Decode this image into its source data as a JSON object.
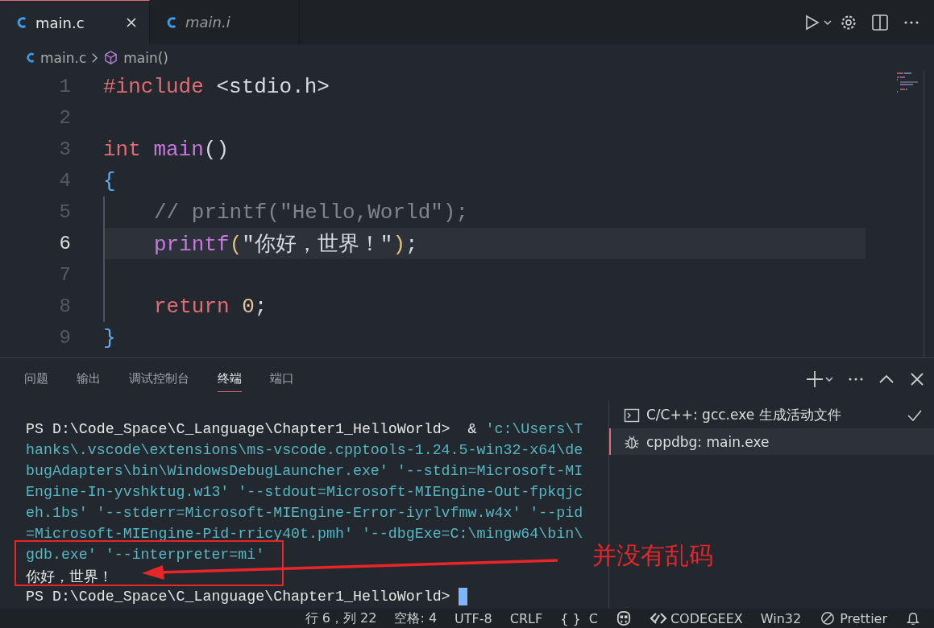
{
  "editor_tabs": [
    {
      "label": "main.c",
      "selected": true,
      "italic": false,
      "closable": true
    },
    {
      "label": "main.i",
      "selected": false,
      "italic": true,
      "closable": false
    }
  ],
  "breadcrumbs": [
    {
      "label": "main.c",
      "kind": "file"
    },
    {
      "label": "main()",
      "kind": "symbol"
    }
  ],
  "code_lines": [
    {
      "number": "1",
      "current": false,
      "indent": false,
      "tokens": [
        {
          "text": "#include",
          "kind": "keyword"
        },
        {
          "text": " <stdio.h>",
          "kind": "plain"
        }
      ]
    },
    {
      "number": "2",
      "current": false,
      "indent": false
    },
    {
      "number": "3",
      "current": false,
      "indent": false,
      "tokens": [
        {
          "text": "int",
          "kind": "keyword"
        },
        {
          "text": " main",
          "kind": "function"
        },
        {
          "text": "()",
          "kind": "plain"
        }
      ]
    },
    {
      "number": "4",
      "current": false,
      "indent": false,
      "tokens": [
        {
          "text": "{",
          "kind": "brace"
        }
      ]
    },
    {
      "number": "5",
      "current": false,
      "indent": true,
      "tokens": [
        {
          "text": "// printf(\"Hello,World\");",
          "kind": "comment"
        }
      ]
    },
    {
      "number": "6",
      "current": true,
      "indent": true,
      "tokens": [
        {
          "text": "printf",
          "kind": "function"
        },
        {
          "text": "(",
          "kind": "paren"
        },
        {
          "text": "\"你好，世界！\"",
          "kind": "string"
        },
        {
          "text": ")",
          "kind": "paren"
        },
        {
          "text": ";",
          "kind": "plain"
        }
      ]
    },
    {
      "number": "7",
      "current": false,
      "indent": true
    },
    {
      "number": "8",
      "current": false,
      "indent": true,
      "tokens": [
        {
          "text": "return",
          "kind": "keyword"
        },
        {
          "text": " 0",
          "kind": "number"
        },
        {
          "text": ";",
          "kind": "plain"
        }
      ]
    },
    {
      "number": "9",
      "current": false,
      "indent": false,
      "tokens": [
        {
          "text": "}",
          "kind": "brace"
        }
      ]
    }
  ],
  "panel_tabs": [
    {
      "label": "问题",
      "selected": false
    },
    {
      "label": "输出",
      "selected": false
    },
    {
      "label": "调试控制台",
      "selected": false
    },
    {
      "label": "终端",
      "selected": true
    },
    {
      "label": "端口",
      "selected": false
    }
  ],
  "terminal_lines": [
    [
      {
        "text": "PS D:\\Code_Space\\C_Language\\Chapter1_HelloWorld>  & ",
        "kind": "plain"
      },
      {
        "text": "'c:\\Users\\T",
        "kind": "string"
      }
    ],
    [
      {
        "text": "hanks\\.vscode\\extensions\\ms-vscode.cpptools-1.24.5-win32-x64\\de",
        "kind": "string"
      }
    ],
    [
      {
        "text": "bugAdapters\\bin\\WindowsDebugLauncher.exe' '--stdin=Microsoft-MI",
        "kind": "string"
      }
    ],
    [
      {
        "text": "Engine-In-yvshktug.w13' '--stdout=Microsoft-MIEngine-Out-fpkqjc",
        "kind": "string"
      }
    ],
    [
      {
        "text": "eh.1bs' '--stderr=Microsoft-MIEngine-Error-iyrlvfmw.w4x' '--pid",
        "kind": "string"
      }
    ],
    [
      {
        "text": "=Microsoft-MIEngine-Pid-rricy40t.pmh' '--dbgExe=C:\\mingw64\\bin\\",
        "kind": "string"
      }
    ],
    [
      {
        "text": "gdb.exe' '--interpreter=mi'",
        "kind": "string"
      }
    ],
    [
      {
        "text": "你好，世界！",
        "kind": "output"
      }
    ],
    [
      {
        "text": "PS D:\\Code_Space\\C_Language\\Chapter1_HelloWorld>",
        "kind": "plain"
      }
    ]
  ],
  "terminal_list": [
    {
      "label": "C/C++: gcc.exe 生成活动文件",
      "kind": "task",
      "checked": true,
      "selected": false
    },
    {
      "label": "cppdbg: main.exe",
      "kind": "debug",
      "checked": false,
      "selected": true
    }
  ],
  "annotation": {
    "text": "并没有乱码",
    "color": "#e8262a"
  },
  "status_bar": [
    {
      "text": "行 6，列 22",
      "kind": "text"
    },
    {
      "text": "空格: 4",
      "kind": "text"
    },
    {
      "text": "UTF-8",
      "kind": "text"
    },
    {
      "text": "CRLF",
      "kind": "text"
    },
    {
      "text": "{ }  C",
      "kind": "text"
    },
    {
      "kind": "copilot"
    },
    {
      "text": "CODEGEEX",
      "kind": "codegeex"
    },
    {
      "text": "Win32",
      "kind": "text"
    },
    {
      "text": "Prettier",
      "kind": "prettier"
    },
    {
      "kind": "bell"
    }
  ]
}
